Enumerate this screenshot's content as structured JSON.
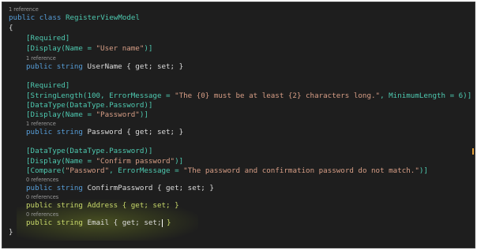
{
  "code": {
    "lens_class": "1 reference",
    "class_decl_kw": "public class",
    "class_name": "RegisterViewModel",
    "open_brace": "{",
    "close_brace": "}",
    "attr_required_1": "[Required]",
    "attr_display_user_pre": "[Display(Name = ",
    "attr_display_user_str": "\"User name\"",
    "attr_display_user_post": ")]",
    "lens_username": "1 reference",
    "prop_username_kw": "public string",
    "prop_username": " UserName { get; set; }",
    "attr_required_2": "[Required]",
    "attr_strlen_pre": "[StringLength(100, ErrorMessage = ",
    "attr_strlen_str": "\"The {0} must be at least {2} characters long.\"",
    "attr_strlen_post": ", MinimumLength = 6)]",
    "attr_datatype_1": "[DataType(DataType.Password)]",
    "attr_display_pw_pre": "[Display(Name = ",
    "attr_display_pw_str": "\"Password\"",
    "attr_display_pw_post": ")]",
    "lens_password": "1 reference",
    "prop_password_kw": "public string",
    "prop_password": " Password { get; set; }",
    "attr_datatype_2": "[DataType(DataType.Password)]",
    "attr_display_cpw_pre": "[Display(Name = ",
    "attr_display_cpw_str": "\"Confirm password\"",
    "attr_display_cpw_post": ")]",
    "attr_compare_pre": "[Compare(",
    "attr_compare_str1": "\"Password\"",
    "attr_compare_mid": ", ErrorMessage = ",
    "attr_compare_str2": "\"The password and confirmation password do not match.\"",
    "attr_compare_post": ")]",
    "lens_confirm": "0 references",
    "prop_confirm_kw": "public string",
    "prop_confirm": " ConfirmPassword { get; set; }",
    "lens_address": "0 references",
    "prop_address_kw": "public string",
    "prop_address": " Address { get; set; }",
    "lens_email": "0 references",
    "prop_email_kw": "public string",
    "prop_email": " Email { get; set;",
    "prop_email_end": " }"
  },
  "colors": {
    "background": "#1e1e1e",
    "keyword": "#569cd6",
    "type": "#4ec9b0",
    "string": "#d69d85",
    "highlight": "#c8d86a"
  }
}
